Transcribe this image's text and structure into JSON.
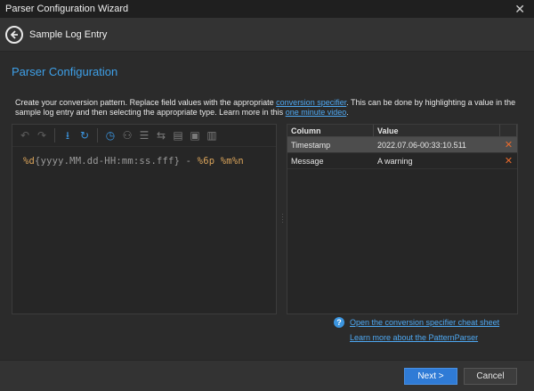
{
  "window": {
    "title": "Parser Configuration Wizard",
    "close_glyph": "✕"
  },
  "header": {
    "breadcrumb": "Sample Log Entry"
  },
  "section": {
    "title": "Parser Configuration"
  },
  "description": {
    "text_1": "Create your conversion pattern.  Replace field values with the appropriate ",
    "link_1": "conversion specifier",
    "text_2": ".  This can be done by highlighting a value in the sample log entry and then selecting the appropriate type.  Learn more in this ",
    "link_2": "one minute video",
    "text_3": "."
  },
  "toolbar": {
    "icons": [
      "undo-icon",
      "redo-icon",
      "download-icon",
      "refresh-icon",
      "clock-icon",
      "hierarchy-icon",
      "list-icon",
      "network-icon",
      "document-icon",
      "add-document-icon",
      "remove-document-icon"
    ]
  },
  "pattern": {
    "seg1": "%d",
    "seg2": "{yyyy.MM.dd-HH:mm:ss.fff}",
    "seg3": " - ",
    "seg4": "%6p",
    "seg5": " ",
    "seg6": "%m",
    "seg7": "%n"
  },
  "grid": {
    "columns": [
      "Column",
      "Value"
    ],
    "rows": [
      {
        "column": "Timestamp",
        "value": "2022.07.06-00:33:10.511",
        "delete": "✕"
      },
      {
        "column": "Message",
        "value": "A warning",
        "delete": "✕"
      }
    ]
  },
  "links": {
    "help_glyph": "?",
    "cheat_sheet": "Open the conversion specifier cheat sheet",
    "pattern_parser": "Learn more about the PatternParser"
  },
  "buttons": {
    "next": "Next >",
    "cancel": "Cancel"
  },
  "colors": {
    "accent": "#3b95e0",
    "delete": "#e86a2c",
    "specifier": "#d9a35a"
  }
}
